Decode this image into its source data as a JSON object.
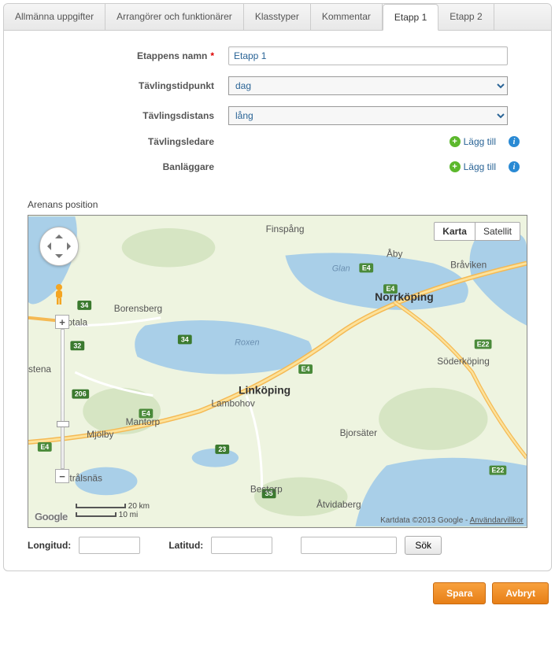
{
  "tabs": [
    "Allmänna uppgifter",
    "Arrangörer och funktionärer",
    "Klasstyper",
    "Kommentar",
    "Etapp 1",
    "Etapp 2"
  ],
  "active_tab": 4,
  "form": {
    "name_label": "Etappens namn",
    "name_value": "Etapp 1",
    "time_label": "Tävlingstidpunkt",
    "time_value": "dag",
    "dist_label": "Tävlingsdistans",
    "dist_value": "lång",
    "leader_label": "Tävlingsledare",
    "planner_label": "Banläggare",
    "add_link": "Lägg till"
  },
  "map": {
    "section_label": "Arenans position",
    "type_map": "Karta",
    "type_sat": "Satellit",
    "scale_km": "20 km",
    "scale_mi": "10 mi",
    "logo": "Google",
    "attrib_text": "Kartdata ©2013 Google - ",
    "attrib_link": "Användarvillkor",
    "cities": {
      "finspang": "Finspång",
      "aby": "Åby",
      "braviken": "Bråviken",
      "glan": "Glan",
      "norrkoping": "Norrköping",
      "borensberg": "Borensberg",
      "motala": "Motala",
      "roxen": "Roxen",
      "soderkoping": "Söderköping",
      "stena": "stena",
      "linkoping": "Linköping",
      "lambohov": "Lambohov",
      "mantorp": "Mantorp",
      "mjolby": "Mjölby",
      "bjorsater": "Bjorsäter",
      "stralsnas": "Strålsnäs",
      "bestorp": "Bestorp",
      "atvidaberg": "Åtvidaberg"
    },
    "roads": {
      "e4": "E4",
      "e22": "E22",
      "r34": "34",
      "r32": "32",
      "r206": "206",
      "r23": "23",
      "r35": "35"
    }
  },
  "coords": {
    "lon_label": "Longitud:",
    "lat_label": "Latitud:",
    "search_btn": "Sök"
  },
  "footer": {
    "save": "Spara",
    "cancel": "Avbryt"
  }
}
